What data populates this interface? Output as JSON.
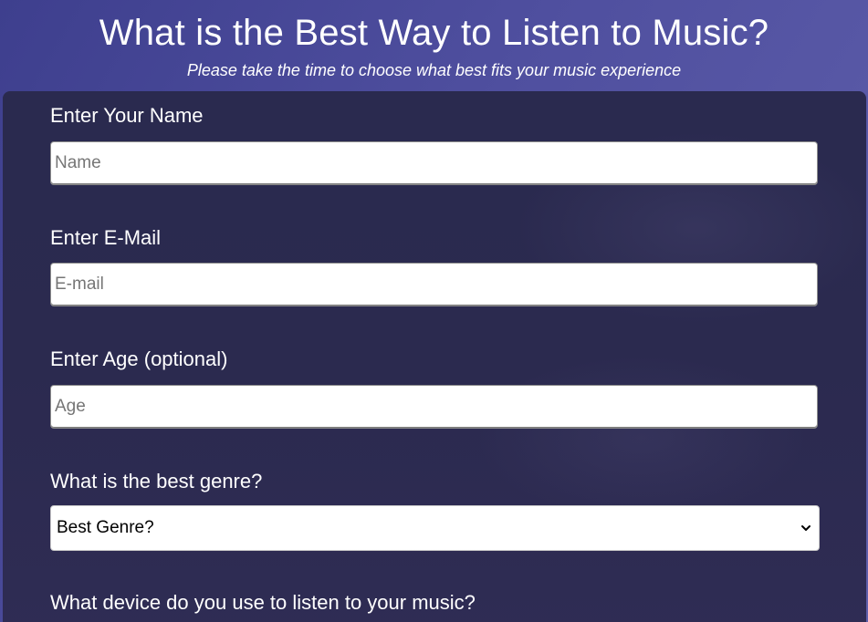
{
  "header": {
    "title": "What is the Best Way to Listen to Music?",
    "subtitle": "Please take the time to choose what best fits your music experience"
  },
  "form": {
    "name": {
      "label": "Enter Your Name",
      "placeholder": "Name",
      "value": ""
    },
    "email": {
      "label": "Enter E-Mail",
      "placeholder": "E-mail",
      "value": ""
    },
    "age": {
      "label": "Enter Age (optional)",
      "placeholder": "Age",
      "value": ""
    },
    "genre": {
      "label": "What is the best genre?",
      "selected": "Best Genre?",
      "icon": "chevron-down-icon"
    },
    "device": {
      "label": "What device do you use to listen to your music?"
    }
  },
  "colors": {
    "header_bg": "#4f4f9f",
    "panel_bg": "#2b2a4f",
    "text": "#ffffff",
    "input_bg": "#ffffff",
    "placeholder": "#767676"
  }
}
